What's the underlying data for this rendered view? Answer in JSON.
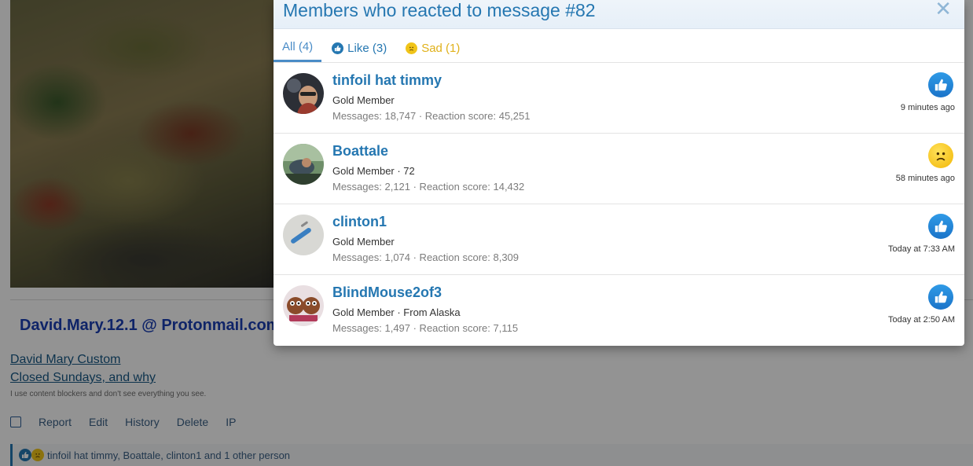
{
  "background": {
    "sig_email": "David.Mary.12.1 @ Protonmail.com",
    "sig_links": [
      "David Mary Custom",
      "Closed Sundays, and why"
    ],
    "sig_note": "I use content blockers and don't see everything you see.",
    "actions": [
      "Report",
      "Edit",
      "History",
      "Delete",
      "IP"
    ],
    "reaction_summary": "tinfoil hat timmy, Boattale, clinton1 and 1 other person"
  },
  "modal": {
    "title": "Members who reacted to message #82",
    "close_symbol": "✕",
    "tabs": [
      {
        "label": "All (4)"
      },
      {
        "label": "Like (3)"
      },
      {
        "label": "Sad (1)"
      }
    ],
    "members": [
      {
        "name": "tinfoil hat timmy",
        "title": "Gold Member",
        "stats": "Messages: 18,747 · Reaction score: 45,251",
        "reaction": "like",
        "time": "9 minutes ago"
      },
      {
        "name": "Boattale",
        "title": "Gold Member · 72",
        "stats": "Messages: 2,121 · Reaction score: 14,432",
        "reaction": "sad",
        "time": "58 minutes ago"
      },
      {
        "name": "clinton1",
        "title": "Gold Member",
        "stats": "Messages: 1,074 · Reaction score: 8,309",
        "reaction": "like",
        "time": "Today at 7:33 AM"
      },
      {
        "name": "BlindMouse2of3",
        "title": "Gold Member · From Alaska",
        "stats": "Messages: 1,497 · Reaction score: 7,115",
        "reaction": "like",
        "time": "Today at 2:50 AM"
      }
    ]
  },
  "colors": {
    "accent": "#2577b1",
    "like": "#1b74c9",
    "sad": "#f2b705",
    "signature_email": "#1b3fb3"
  }
}
